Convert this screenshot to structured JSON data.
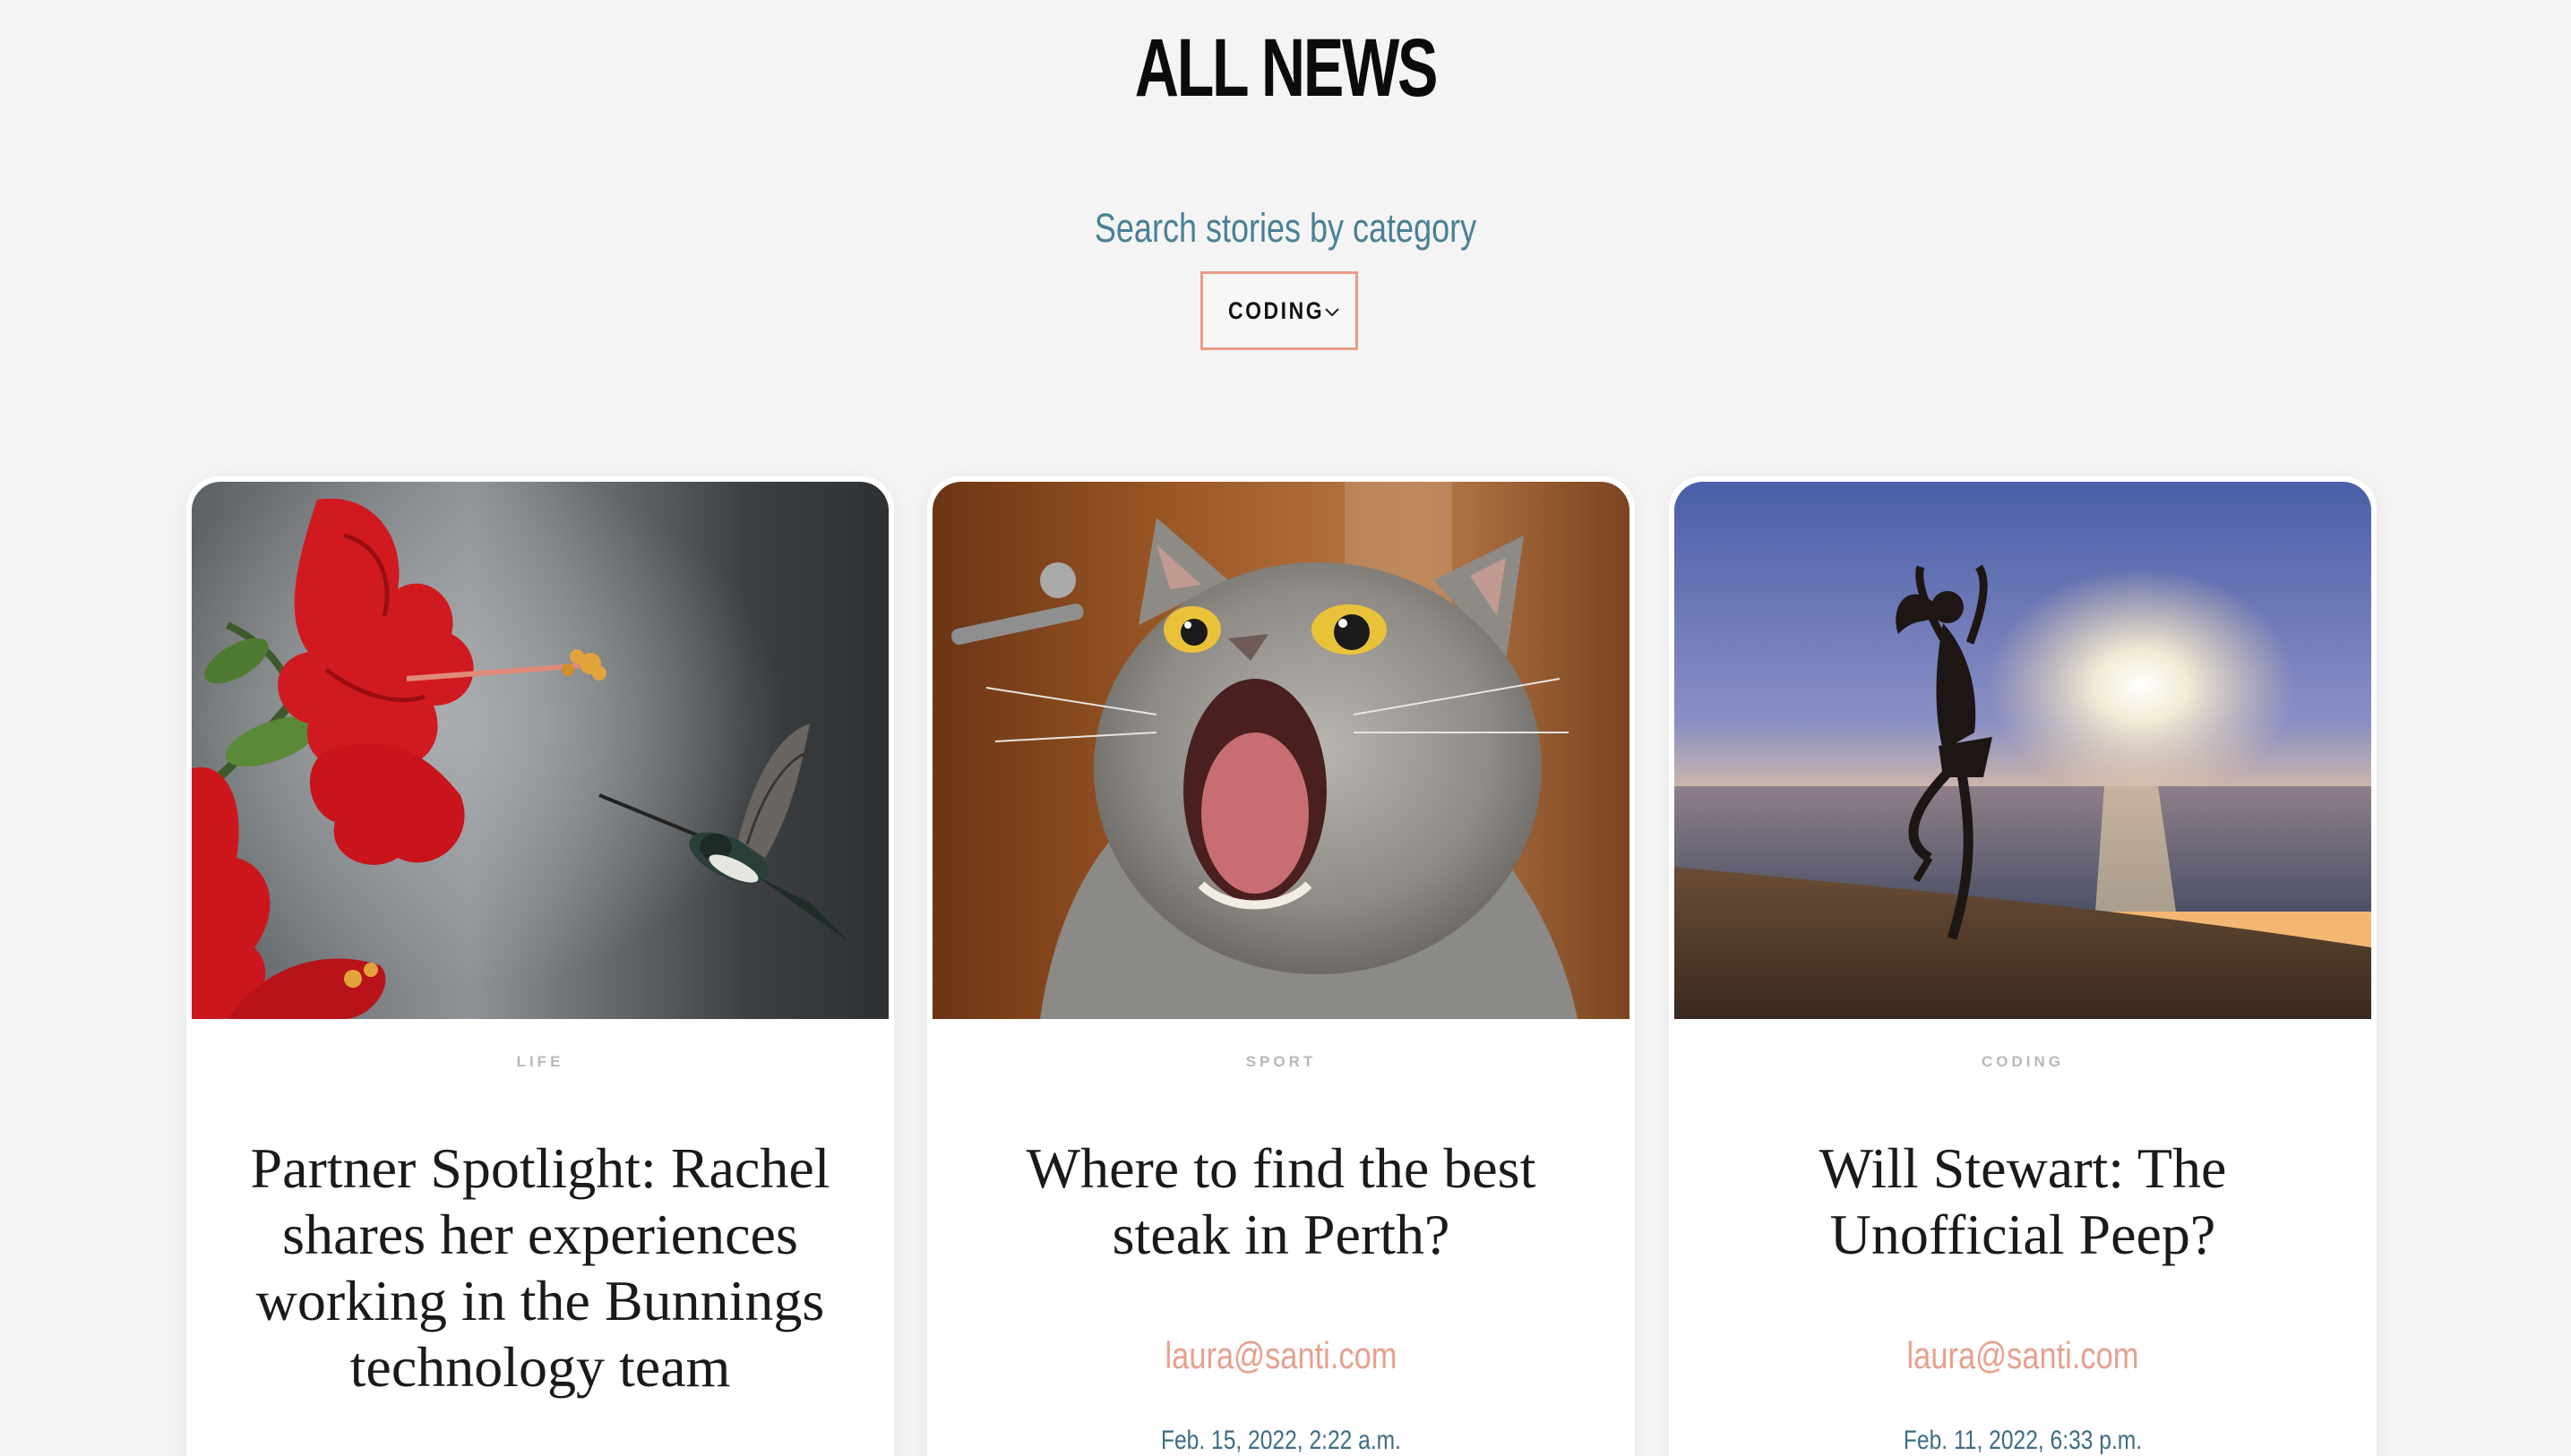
{
  "header": {
    "title": "ALL NEWS",
    "search_label": "Search stories by category"
  },
  "filter": {
    "selected": "CODING"
  },
  "colors": {
    "accent_border": "#e99c88",
    "label_blue": "#4a8095",
    "author_salmon": "#e8a08c"
  },
  "cards": [
    {
      "category": "LIFE",
      "headline": "Partner Spotlight: Rachel shares her experiences working in the Bunnings technology team",
      "author": "",
      "date": "",
      "image": "hummingbird-hibiscus-photo"
    },
    {
      "category": "SPORT",
      "headline": "Where to find the best steak in Perth?",
      "author": "laura@santi.com",
      "date": "Feb. 15, 2022, 2:22 a.m.",
      "image": "surprised-cat-photo"
    },
    {
      "category": "CODING",
      "headline": "Will Stewart: The Unofficial Peep?",
      "author": "laura@santi.com",
      "date": "Feb. 11, 2022, 6:33 p.m.",
      "image": "beach-sunset-dancer-photo"
    }
  ]
}
